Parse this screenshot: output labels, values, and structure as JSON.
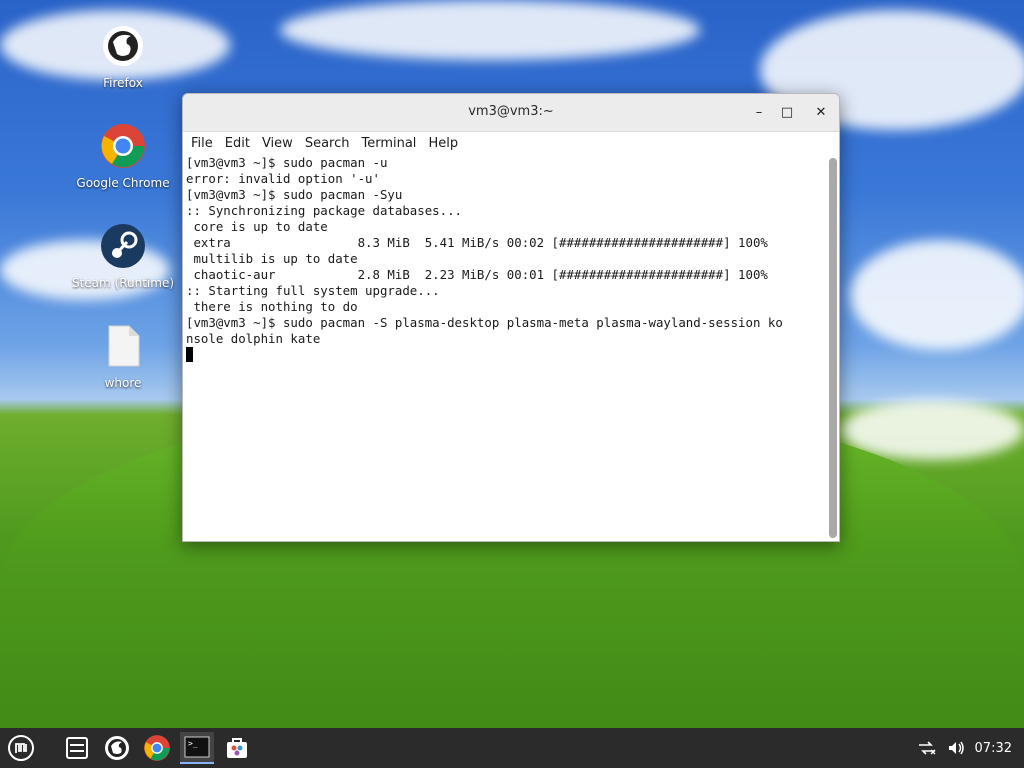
{
  "desktop": {
    "icons": [
      {
        "label": "Firefox",
        "icon": "firefox-icon"
      },
      {
        "label": "Google Chrome",
        "icon": "chrome-icon"
      },
      {
        "label": "Steam (Runtime)",
        "icon": "steam-icon"
      },
      {
        "label": "whore",
        "icon": "file-icon"
      }
    ]
  },
  "window": {
    "title": "vm3@vm3:~",
    "controls": {
      "minimize": "–",
      "maximize": "□",
      "close": "✕"
    },
    "menu": [
      "File",
      "Edit",
      "View",
      "Search",
      "Terminal",
      "Help"
    ]
  },
  "terminal": {
    "lines": [
      "[vm3@vm3 ~]$ sudo pacman -u",
      "error: invalid option '-u'",
      "[vm3@vm3 ~]$ sudo pacman -Syu",
      ":: Synchronizing package databases...",
      " core is up to date",
      " extra                 8.3 MiB  5.41 MiB/s 00:02 [######################] 100%",
      " multilib is up to date",
      " chaotic-aur           2.8 MiB  2.23 MiB/s 00:01 [######################] 100%",
      ":: Starting full system upgrade...",
      " there is nothing to do",
      "[vm3@vm3 ~]$ sudo pacman -S plasma-desktop plasma-meta plasma-wayland-session ko",
      "nsole dolphin kate"
    ]
  },
  "taskbar": {
    "items": [
      "menu-icon",
      "file-manager-icon",
      "firefox-icon",
      "chrome-icon",
      "terminal-icon",
      "software-center-icon"
    ],
    "clock": "07:32"
  },
  "colors": {
    "taskbar": "#2b2b2b",
    "titlebar": "#ececec",
    "accent": "#8ab4f8"
  }
}
